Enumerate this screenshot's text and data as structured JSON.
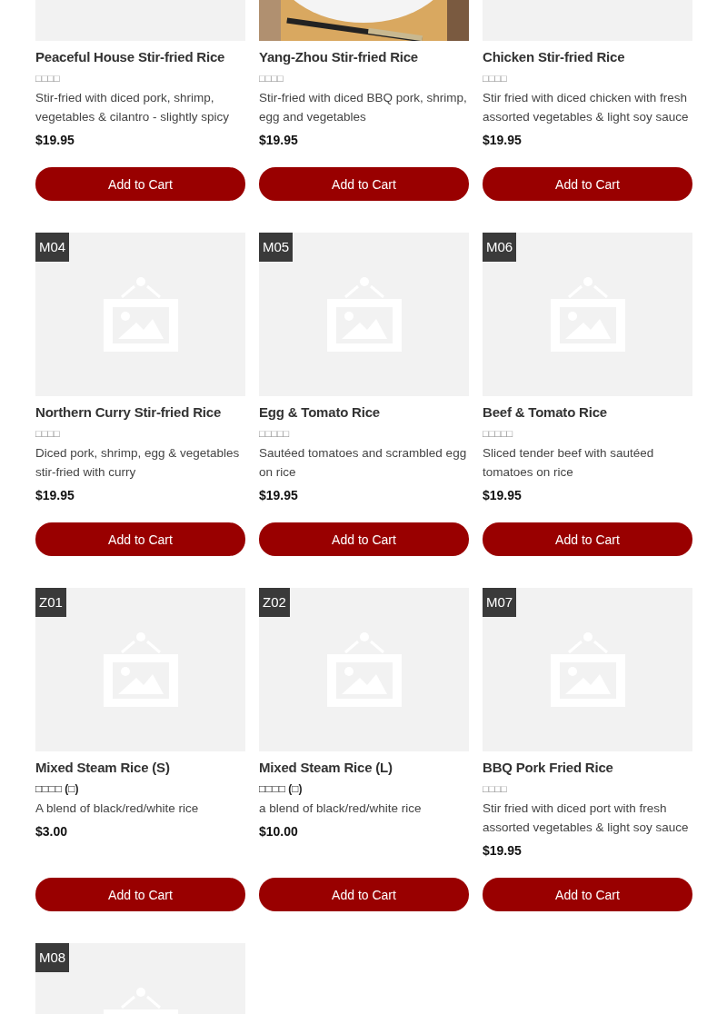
{
  "menu_items": [
    {
      "name": "Peaceful House Stir-fried Rice",
      "subtitle": "□□□□",
      "subtitle_bold": false,
      "description": "Stir-fried with diced pork, shrimp, vegetables & cilantro - slightly spicy",
      "price": "$19.95",
      "button": "Add to Cart"
    },
    {
      "kind": "picture",
      "name": "Yang-Zhou Stir-fried Rice",
      "subtitle": "□□□□",
      "subtitle_bold": false,
      "description": "Stir-fried with diced BBQ pork, shrimp, egg and vegetables",
      "price": "$19.95",
      "button": "Add to Cart"
    },
    {
      "name": "Chicken Stir-fried Rice",
      "subtitle": "□□□□",
      "subtitle_bold": false,
      "description": "Stir fried with diced chicken with fresh assorted vegetables & light soy sauce",
      "price": "$19.95",
      "button": "Add to Cart"
    },
    {
      "code": "M04",
      "name": "Northern Curry Stir-fried Rice",
      "subtitle": "□□□□",
      "subtitle_bold": false,
      "description": "Diced pork, shrimp, egg & vegetables stir-fried with curry",
      "price": "$19.95",
      "button": "Add to Cart"
    },
    {
      "code": "M05",
      "name": "Egg & Tomato Rice",
      "subtitle": "□□□□□",
      "subtitle_bold": false,
      "description": "Sautéed tomatoes and scrambled egg on rice",
      "price": "$19.95",
      "button": "Add to Cart"
    },
    {
      "code": "M06",
      "name": "Beef & Tomato Rice",
      "subtitle": "□□□□□",
      "subtitle_bold": false,
      "description": "Sliced tender beef with sautéed tomatoes on rice",
      "price": "$19.95",
      "button": "Add to Cart"
    },
    {
      "code": "Z01",
      "name": "Mixed Steam Rice (S)",
      "subtitle": "□□□□ (□)",
      "subtitle_bold": true,
      "description": "A blend of black/red/white rice",
      "price": "$3.00",
      "button": "Add to Cart"
    },
    {
      "code": "Z02",
      "name": "Mixed Steam Rice (L)",
      "subtitle": "□□□□ (□)",
      "subtitle_bold": true,
      "description": "a blend of black/red/white rice",
      "price": "$10.00",
      "button": "Add to Cart"
    },
    {
      "code": "M07",
      "name": "BBQ Pork Fried Rice",
      "subtitle": "□□□□",
      "subtitle_bold": false,
      "description": "Stir fried with diced port with fresh assorted vegetables & light soy sauce",
      "price": "$19.95",
      "button": "Add to Cart"
    },
    {
      "code": "M08"
    }
  ]
}
